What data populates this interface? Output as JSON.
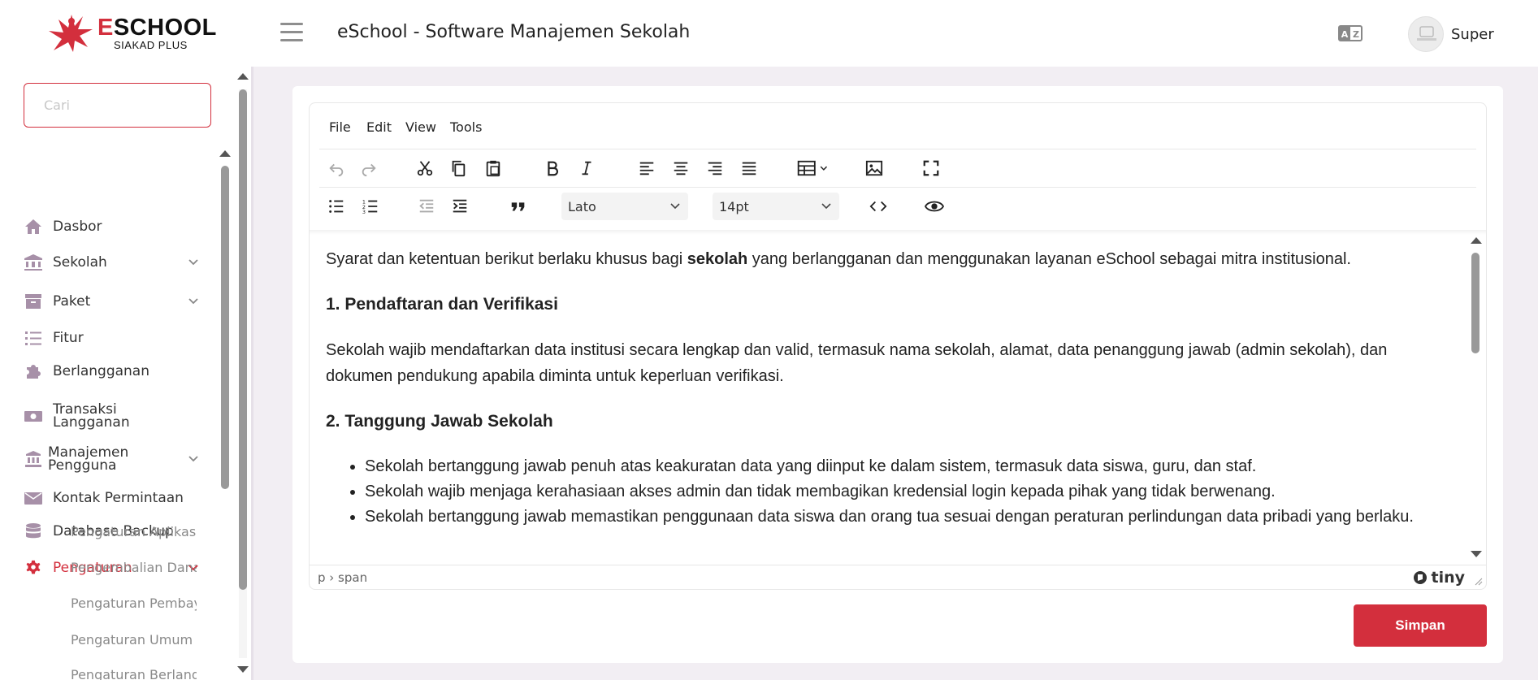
{
  "header": {
    "logo_title_e": "E",
    "logo_title_rest": "SCHOOL",
    "logo_subtitle": "SIAKAD PLUS",
    "app_title": "eSchool - Software Manajemen Sekolah",
    "user_name": "Super",
    "lang_icon": "translate-icon",
    "menu_icon": "hamburger-icon"
  },
  "sidebar": {
    "search_placeholder": "Cari",
    "items": [
      {
        "label": "Dasbor",
        "icon": "home-icon"
      },
      {
        "label": "Sekolah",
        "icon": "bank-icon"
      },
      {
        "label": "Paket",
        "icon": "archive-icon"
      },
      {
        "label": "Fitur",
        "icon": "list-icon"
      },
      {
        "label": "Berlangganan",
        "icon": "puzzle-icon"
      },
      {
        "label": "Transaksi Langganan",
        "icon": "money-icon"
      },
      {
        "label": "Manajemen Pengguna",
        "icon": "users-icon"
      },
      {
        "label": "Kontak Permintaan",
        "icon": "mail-icon"
      },
      {
        "label": "Database Backup",
        "icon": "database-icon"
      },
      {
        "label": "Pengaturan",
        "icon": "gear-icon"
      }
    ],
    "sub_items": [
      "Pengaturan Aplikasi",
      "Pengembalian Dana",
      "Pengaturan Pembayaran",
      "Pengaturan Umum",
      "Pengaturan Berlangganan"
    ],
    "active_color": "#d32f3d"
  },
  "editor": {
    "menus": [
      "File",
      "Edit",
      "View",
      "Tools"
    ],
    "font_family": "Lato",
    "font_size": "14pt",
    "content": {
      "intro_before": "Syarat dan ketentuan berikut berlaku khusus bagi ",
      "intro_bold": "sekolah",
      "intro_after": " yang berlangganan dan menggunakan layanan eSchool sebagai mitra institusional.",
      "h1": "1. Pendaftaran dan Verifikasi",
      "p1": "Sekolah wajib mendaftarkan data institusi secara lengkap dan valid, termasuk nama sekolah, alamat, data penanggung jawab (admin sekolah), dan dokumen pendukung apabila diminta untuk keperluan verifikasi.",
      "h2": "2. Tanggung Jawab Sekolah",
      "bullets": [
        "Sekolah bertanggung jawab penuh atas keakuratan data yang diinput ke dalam sistem, termasuk data siswa, guru, dan staf.",
        "Sekolah wajib menjaga kerahasiaan akses admin dan tidak membagikan kredensial login kepada pihak yang tidak berwenang.",
        "Sekolah bertanggung jawab memastikan penggunaan data siswa dan orang tua sesuai dengan peraturan perlindungan data pribadi yang berlaku."
      ]
    },
    "status_path": "p › span",
    "brand": "tiny"
  },
  "actions": {
    "save_label": "Simpan"
  }
}
